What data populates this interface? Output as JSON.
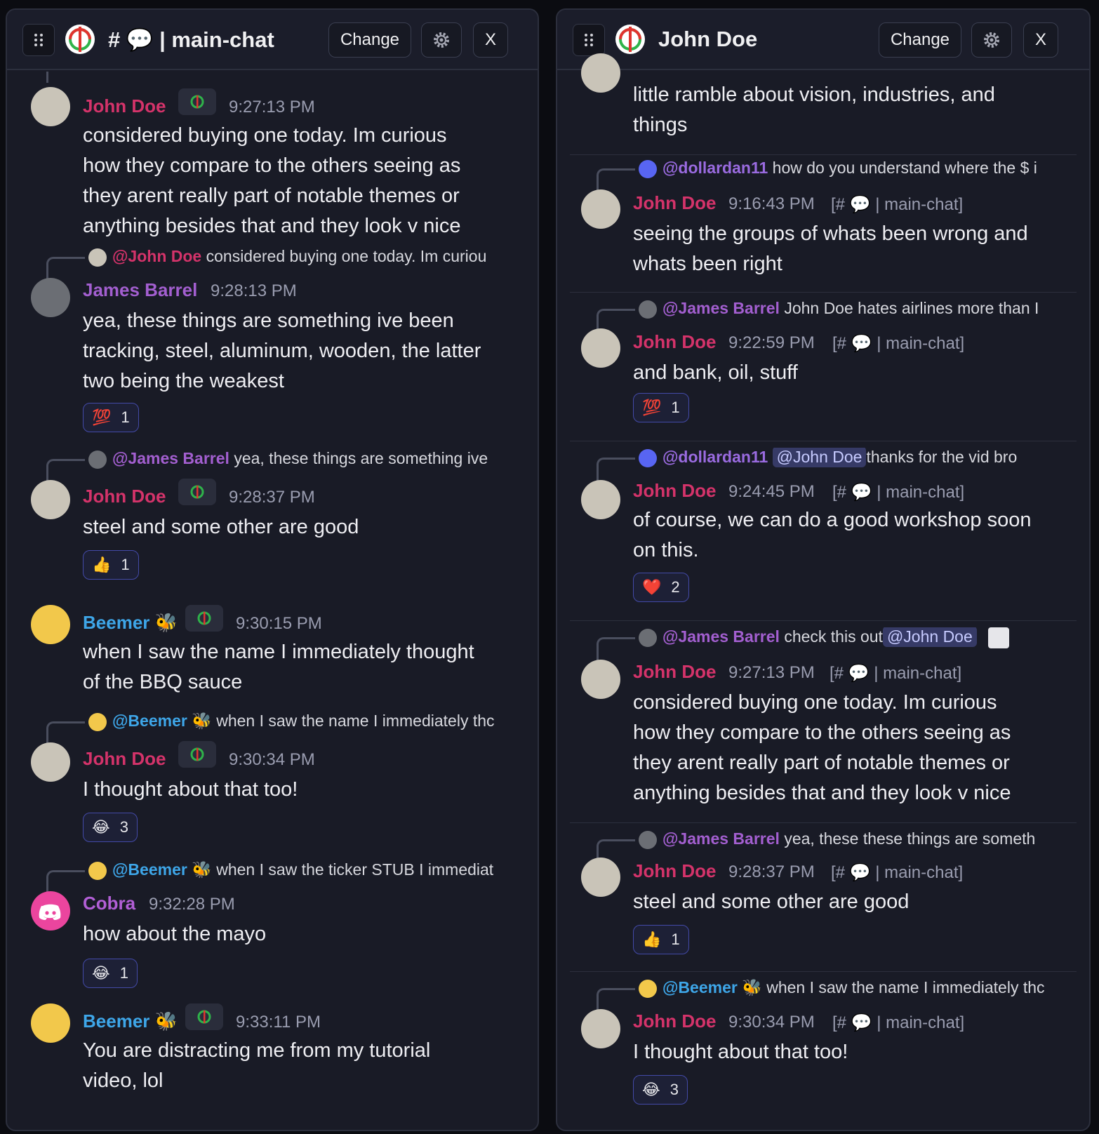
{
  "colors": {
    "john": "#d4336a",
    "james": "#a35fd0",
    "beemer": "#3ea6e8",
    "cobra": "#b25fd6",
    "dollardan": "#9a6be0",
    "reaction_border": "#434aa8"
  },
  "left": {
    "title": "# 💬 | main-chat",
    "change_label": "Change",
    "close_label": "X",
    "messages": [
      {
        "author": "John Doe",
        "time": "9:27:13 PM",
        "lines": [
          "considered buying one today. Im curious",
          "how they compare to the others seeing as",
          "they arent really part of notable themes or",
          "anything besides that and they look v nice"
        ]
      },
      {
        "reply_to": "@John Doe",
        "reply_text": "considered buying one today. Im curiou",
        "author": "James Barrel",
        "time": "9:28:13 PM",
        "lines": [
          "yea, these things are something ive been",
          "tracking, steel, aluminum, wooden, the latter",
          "two being the weakest"
        ],
        "reaction": {
          "emoji": "💯",
          "count": "1"
        }
      },
      {
        "reply_to": "@James Barrel",
        "reply_text": "yea, these things are something ive",
        "author": "John Doe",
        "time": "9:28:37 PM",
        "lines": [
          "steel and some other are good"
        ],
        "reaction": {
          "emoji": "👍",
          "count": "1"
        }
      },
      {
        "author": "Beemer 🐝",
        "time": "9:30:15 PM",
        "lines": [
          "when I saw the name I immediately thought",
          "of the BBQ sauce"
        ]
      },
      {
        "reply_to": "@Beemer 🐝",
        "reply_text": "when I saw the name I immediately thc",
        "author": "John Doe",
        "time": "9:30:34 PM",
        "lines": [
          "I thought about that too!"
        ],
        "reaction": {
          "emoji": "😂",
          "count": "3"
        }
      },
      {
        "reply_to": "@Beemer 🐝",
        "reply_text": "when I saw the ticker STUB I immediat",
        "author": "Cobra",
        "time": "9:32:28 PM",
        "lines": [
          "how about the mayo"
        ],
        "reaction": {
          "emoji": "😂",
          "count": "1"
        }
      },
      {
        "author": "Beemer 🐝",
        "time": "9:33:11 PM",
        "lines": [
          "You are distracting me from my tutorial",
          "video, lol"
        ]
      }
    ]
  },
  "right": {
    "title": "John Doe",
    "change_label": "Change",
    "close_label": "X",
    "channel": "[# 💬 | main-chat]",
    "top_partial_lines": [
      "little ramble about vision, industries, and",
      "things"
    ],
    "messages": [
      {
        "reply_to": "@dollardan11",
        "reply_text": "how do you understand where the $ i",
        "author": "John Doe",
        "time": "9:16:43 PM",
        "lines": [
          "seeing the groups of whats been wrong and",
          "whats been right"
        ]
      },
      {
        "reply_to": "@James Barrel",
        "reply_text": "John Doe hates airlines more than I",
        "author": "John Doe",
        "time": "9:22:59 PM",
        "lines": [
          "and bank, oil, stuff"
        ],
        "reaction": {
          "emoji": "💯",
          "count": "1"
        }
      },
      {
        "reply_to": "@dollardan11",
        "reply_mention": "@John Doe",
        "reply_text": "thanks for the vid bro",
        "author": "John Doe",
        "time": "9:24:45 PM",
        "lines": [
          "of course, we can do a good workshop soon",
          "on this."
        ],
        "reaction": {
          "emoji": "❤️",
          "count": "2"
        }
      },
      {
        "reply_to": "@James Barrel",
        "reply_text": "check this out",
        "reply_mention": "@John Doe",
        "author": "John Doe",
        "time": "9:27:13 PM",
        "lines": [
          "considered buying one today. Im curious",
          "how they compare to the others seeing as",
          "they arent really part of notable themes or",
          "anything besides that and they look v nice"
        ]
      },
      {
        "reply_to": "@James Barrel",
        "reply_text": "yea, these these things are someth",
        "author": "John Doe",
        "time": "9:28:37 PM",
        "lines": [
          "steel and some other are good"
        ],
        "reaction": {
          "emoji": "👍",
          "count": "1"
        }
      },
      {
        "reply_to": "@Beemer 🐝",
        "reply_text": "when I saw the name I immediately thc",
        "author": "John Doe",
        "time": "9:30:34 PM",
        "lines": [
          "I thought about that too!"
        ],
        "reaction": {
          "emoji": "😂",
          "count": "3"
        }
      }
    ]
  },
  "icons": {
    "grip": "drag-grip-icon",
    "gear": "gear-icon",
    "logo": "target-logo-icon",
    "discord": "discord-icon",
    "image": "image-icon"
  }
}
